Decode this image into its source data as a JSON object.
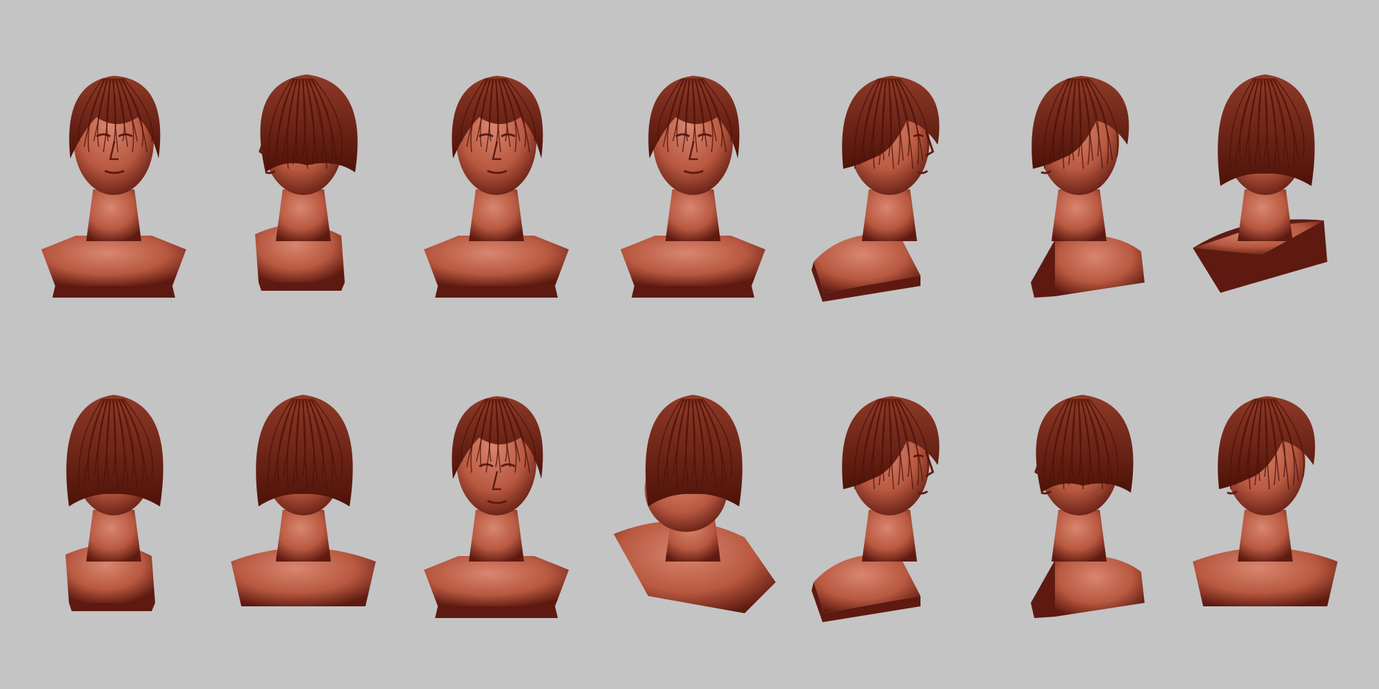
{
  "scene": {
    "background_color": "#c4c4c4",
    "clay_color": "#b85840",
    "clay_light": "#d98670",
    "clay_shadow": "#5e1a10",
    "hair_color": "#8f3a28",
    "hair_dark": "#4e1208"
  },
  "views": [
    {
      "id": "front-1",
      "face": "front",
      "hair": "front",
      "pedestal": "front-low"
    },
    {
      "id": "back-left-profile",
      "face": "left-back",
      "hair": "back-side",
      "pedestal": "cut-small"
    },
    {
      "id": "front-3",
      "face": "front",
      "hair": "front",
      "pedestal": "front-low"
    },
    {
      "id": "front-4",
      "face": "front",
      "hair": "front",
      "pedestal": "front-low"
    },
    {
      "id": "right-profile",
      "face": "right",
      "hair": "side",
      "pedestal": "side-box"
    },
    {
      "id": "left-three-quarter",
      "face": "left",
      "hair": "side",
      "pedestal": "side-box-right"
    },
    {
      "id": "back-right",
      "face": "back",
      "hair": "back",
      "pedestal": "back-box"
    },
    {
      "id": "back-three-quarter",
      "face": "back",
      "hair": "back",
      "pedestal": "cut-small"
    },
    {
      "id": "back",
      "face": "back",
      "hair": "back",
      "pedestal": "back-low"
    },
    {
      "id": "front-looking-down",
      "face": "front-down",
      "hair": "front",
      "pedestal": "front-low"
    },
    {
      "id": "top-down",
      "face": "top",
      "hair": "top",
      "pedestal": "tilted"
    },
    {
      "id": "right-side-low",
      "face": "right",
      "hair": "side",
      "pedestal": "side-box"
    },
    {
      "id": "left-profile-back",
      "face": "left-back",
      "hair": "back-side",
      "pedestal": "side-box-right"
    },
    {
      "id": "left-profile",
      "face": "left",
      "hair": "side",
      "pedestal": "back-low"
    }
  ]
}
